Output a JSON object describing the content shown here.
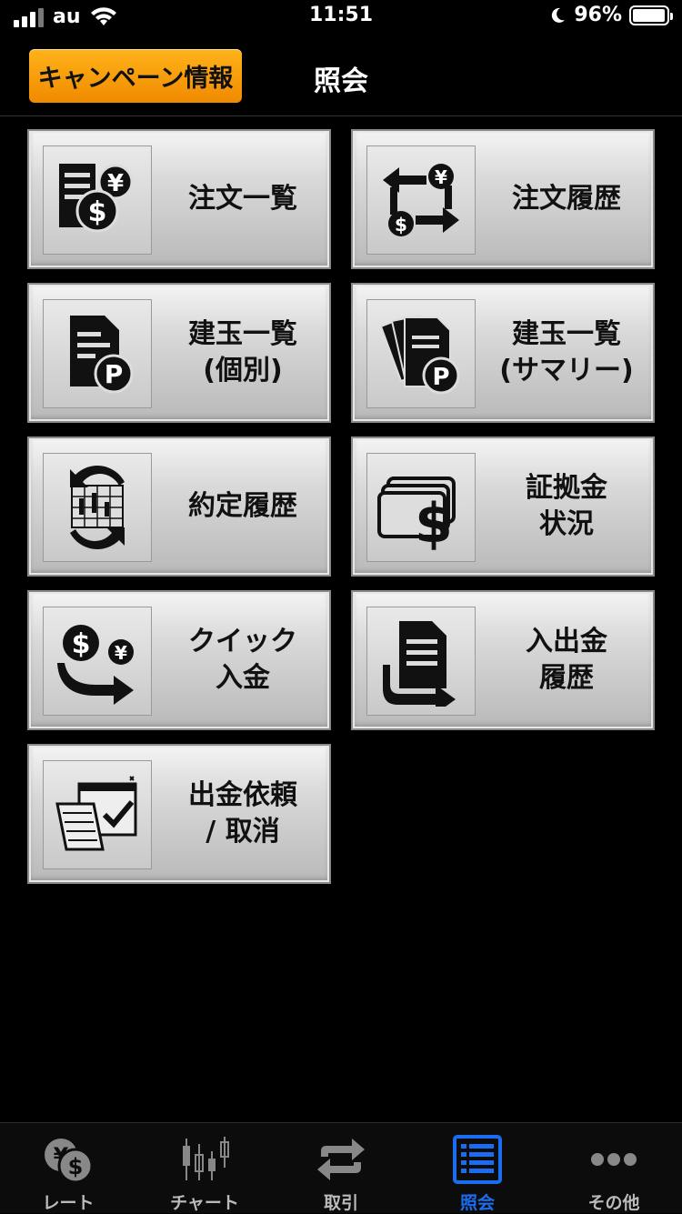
{
  "status_bar": {
    "carrier": "au",
    "time": "11:51",
    "battery_percent": "96%",
    "battery_level": 0.96
  },
  "header": {
    "campaign_button": "キャンペーン情報",
    "title": "照会"
  },
  "tiles": [
    {
      "lines": [
        "注文一覧"
      ],
      "icon": "order-list-icon"
    },
    {
      "lines": [
        "注文履歴"
      ],
      "icon": "order-history-icon"
    },
    {
      "lines": [
        "建玉一覧",
        "(個別)"
      ],
      "icon": "position-list-icon"
    },
    {
      "lines": [
        "建玉一覧",
        "(サマリー)"
      ],
      "icon": "position-summary-icon"
    },
    {
      "lines": [
        "約定履歴"
      ],
      "icon": "execution-history-icon"
    },
    {
      "lines": [
        "証拠金",
        "状況"
      ],
      "icon": "margin-status-icon"
    },
    {
      "lines": [
        "クイック",
        "入金"
      ],
      "icon": "quick-deposit-icon"
    },
    {
      "lines": [
        "入出金",
        "履歴"
      ],
      "icon": "deposit-withdraw-history-icon"
    },
    {
      "lines": [
        "出金依頼",
        "/ 取消"
      ],
      "icon": "withdraw-request-icon"
    }
  ],
  "tabbar": {
    "tabs": [
      {
        "label": "レート",
        "icon": "rate-icon"
      },
      {
        "label": "チャート",
        "icon": "chart-icon"
      },
      {
        "label": "取引",
        "icon": "trade-icon"
      },
      {
        "label": "照会",
        "icon": "inquiry-icon"
      },
      {
        "label": "その他",
        "icon": "more-icon"
      }
    ],
    "active_index": 3,
    "active_color": "#1a6df0"
  },
  "colors": {
    "campaign_button": "#f7a10a",
    "background": "#000000"
  }
}
